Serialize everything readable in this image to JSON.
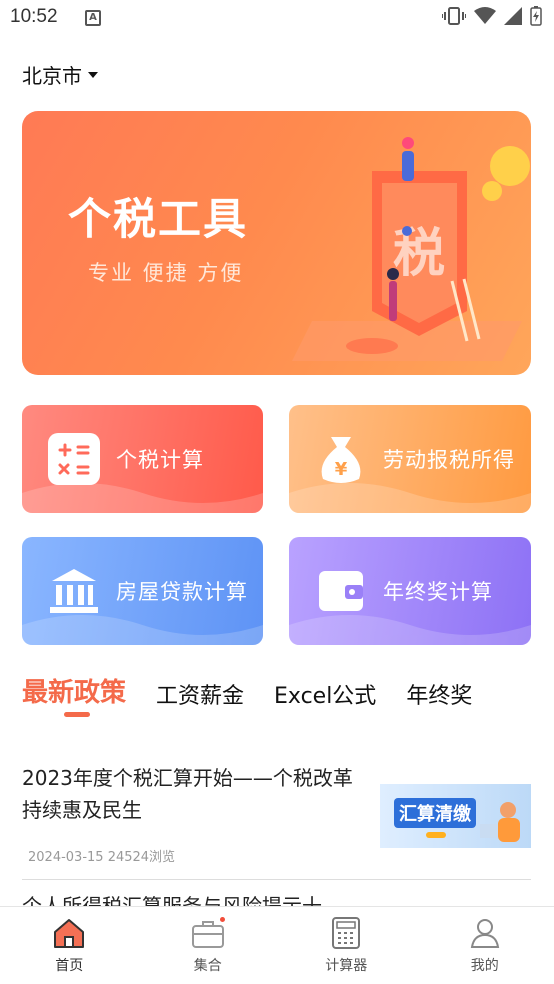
{
  "status_bar": {
    "time": "10:52",
    "notification_glyph": "A"
  },
  "location": {
    "city": "北京市"
  },
  "banner": {
    "title": "个税工具",
    "subtitle": "专业 便捷 方便",
    "badge_char": "税"
  },
  "tiles": [
    {
      "label": "个税计算",
      "icon": "calculator-icon"
    },
    {
      "label": "劳动报税所得",
      "icon": "money-bag-icon"
    },
    {
      "label": "房屋贷款计算",
      "icon": "bank-icon"
    },
    {
      "label": "年终奖计算",
      "icon": "wallet-icon"
    }
  ],
  "tabs": [
    {
      "label": "最新政策",
      "active": true
    },
    {
      "label": "工资薪金",
      "active": false
    },
    {
      "label": "Excel公式",
      "active": false
    },
    {
      "label": "年终奖",
      "active": false
    }
  ],
  "articles": [
    {
      "title": "2023年度个税汇算开始——个税改革持续惠及民生",
      "date": "2024-03-15",
      "views": "24524浏览",
      "thumb_text": "汇算清缴"
    },
    {
      "title": "个人所得税汇算服务与风险提示十"
    }
  ],
  "bottom_nav": [
    {
      "label": "首页",
      "icon": "home-icon",
      "active": true
    },
    {
      "label": "集合",
      "icon": "briefcase-icon",
      "active": false,
      "badge": true
    },
    {
      "label": "计算器",
      "icon": "calculator-icon",
      "active": false
    },
    {
      "label": "我的",
      "icon": "user-icon",
      "active": false
    }
  ],
  "colors": {
    "accent": "#f46a4a",
    "banner": "#ff8a4e",
    "tile_red": "#ff5a4a",
    "tile_orange": "#ff9a40",
    "tile_blue": "#5e93f5",
    "tile_purple": "#8d71f5"
  }
}
